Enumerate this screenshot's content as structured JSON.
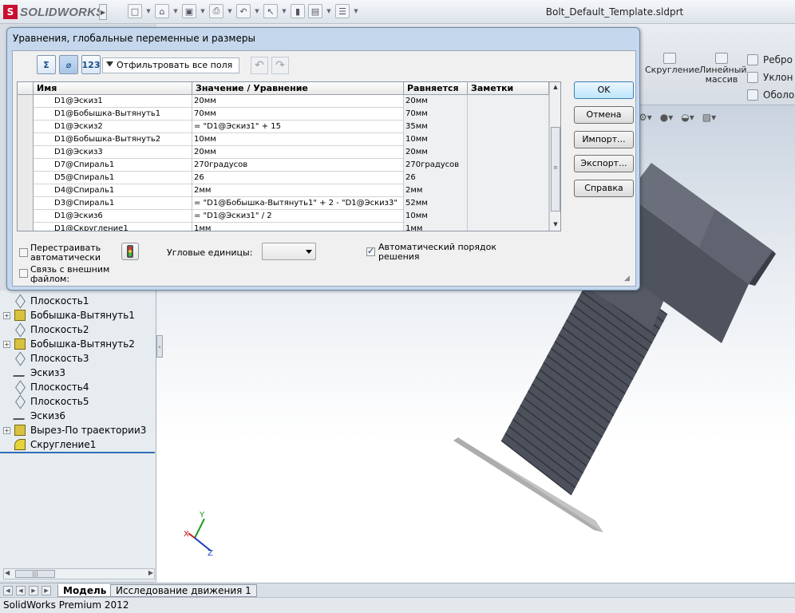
{
  "app": {
    "logo_text": "SOLIDWORKS",
    "document_title": "Bolt_Default_Template.sldprt",
    "status_text": "SolidWorks Premium 2012"
  },
  "ribbon": {
    "fillet_label": "Скругление",
    "pattern_label": "Линейный массив",
    "rib_label": "Ребро",
    "draft_label": "Уклон",
    "shell_label": "Оболоч"
  },
  "feature_tree": [
    {
      "label": "Плоскость1",
      "icon": "plane-icon",
      "expandable": false
    },
    {
      "label": "Бобышка-Вытянуть1",
      "icon": "boss-extrude-icon",
      "expandable": true
    },
    {
      "label": "Плоскость2",
      "icon": "plane-icon",
      "expandable": false
    },
    {
      "label": "Бобышка-Вытянуть2",
      "icon": "boss-extrude-icon",
      "expandable": true
    },
    {
      "label": "Плоскость3",
      "icon": "plane-icon",
      "expandable": false
    },
    {
      "label": "Эскиз3",
      "icon": "sketch-icon",
      "expandable": false
    },
    {
      "label": "Плоскость4",
      "icon": "plane-icon",
      "expandable": false
    },
    {
      "label": "Плоскость5",
      "icon": "plane-icon",
      "expandable": false
    },
    {
      "label": "Эскиз6",
      "icon": "sketch-icon",
      "expandable": false
    },
    {
      "label": "Вырез-По траектории3",
      "icon": "swept-cut-icon",
      "expandable": true
    },
    {
      "label": "Скругление1",
      "icon": "fillet-icon",
      "expandable": false
    }
  ],
  "bottom_tabs": {
    "model": "Модель",
    "motion": "Исследование движения 1"
  },
  "triad": {
    "x": "X",
    "y": "Y",
    "z": "Z"
  },
  "dialog": {
    "title": "Уравнения, глобальные переменные и размеры",
    "filter_placeholder": "Отфильтровать все поля",
    "columns": {
      "name": "Имя",
      "value": "Значение / Уравнение",
      "equals": "Равняется",
      "notes": "Заметки"
    },
    "rows": [
      {
        "name": "D1@Эскиз1",
        "value": "20мм",
        "equals": "20мм",
        "notes": ""
      },
      {
        "name": "D1@Бобышка-Вытянуть1",
        "value": "70мм",
        "equals": "70мм",
        "notes": ""
      },
      {
        "name": "D1@Эскиз2",
        "value": "= \"D1@Эскиз1\" + 15",
        "equals": "35мм",
        "notes": ""
      },
      {
        "name": "D1@Бобышка-Вытянуть2",
        "value": "10мм",
        "equals": "10мм",
        "notes": ""
      },
      {
        "name": "D1@Эскиз3",
        "value": "20мм",
        "equals": "20мм",
        "notes": ""
      },
      {
        "name": "D7@Спираль1",
        "value": "270градусов",
        "equals": "270градусов",
        "notes": ""
      },
      {
        "name": "D5@Спираль1",
        "value": "26",
        "equals": "26",
        "notes": ""
      },
      {
        "name": "D4@Спираль1",
        "value": "2мм",
        "equals": "2мм",
        "notes": ""
      },
      {
        "name": "D3@Спираль1",
        "value": "= \"D1@Бобышка-Вытянуть1\" + 2 - \"D1@Эскиз3\"",
        "equals": "52мм",
        "notes": ""
      },
      {
        "name": "D1@Эскиз6",
        "value": "= \"D1@Эскиз1\" / 2",
        "equals": "10мм",
        "notes": ""
      },
      {
        "name": "D1@Скругление1",
        "value": "1мм",
        "equals": "1мм",
        "notes": ""
      }
    ],
    "buttons": {
      "ok": "OK",
      "cancel": "Отмена",
      "import": "Импорт...",
      "export": "Экспорт...",
      "help": "Справка"
    },
    "options": {
      "auto_rebuild": "Перестраивать автоматически",
      "link_external": "Связь с внешним файлом:",
      "angular_units": "Угловые единицы:",
      "auto_order": "Автоматический порядок решения",
      "auto_rebuild_checked": false,
      "link_external_checked": false,
      "auto_order_checked": true,
      "angular_units_value": ""
    }
  },
  "colors": {
    "dialog_bg": "#c4d7ec",
    "accent_blue": "#2f6db5",
    "bolt_color": "#5a5e69"
  }
}
